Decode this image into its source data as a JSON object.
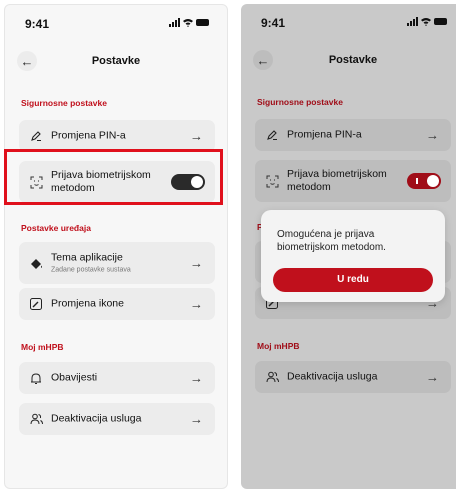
{
  "status": {
    "time": "9:41"
  },
  "header": {
    "title": "Postavke"
  },
  "sections": {
    "security": "Sigurnosne postavke",
    "device": "Postavke uređaja",
    "mymhpb": "Moj mHPB"
  },
  "items": {
    "pin": {
      "label": "Promjena PIN-a",
      "icon": "pen-icon"
    },
    "biometric": {
      "label_line1": "Prijava biometrijskom",
      "label_line2": "metodom",
      "icon": "face-id-icon"
    },
    "theme": {
      "label": "Tema aplikacije",
      "sublabel": "Zadane postavke sustava",
      "icon": "paint-bucket-icon"
    },
    "app_icon": {
      "label": "Promjena ikone",
      "icon": "app-icon"
    },
    "notifications": {
      "label": "Obavijesti",
      "icon": "bell-icon"
    },
    "deactivate": {
      "label": "Deaktivacija usluga",
      "icon": "users-icon"
    }
  },
  "toggles": {
    "left_biometric": "off",
    "right_biometric": "on"
  },
  "modal": {
    "message": "Omogućena je prijava biometrijskom metodom.",
    "ok_label": "U redu"
  },
  "right_screen": {
    "partial_section": "Pos"
  },
  "colors": {
    "accent": "#c0101c",
    "highlight": "#e0101c"
  }
}
